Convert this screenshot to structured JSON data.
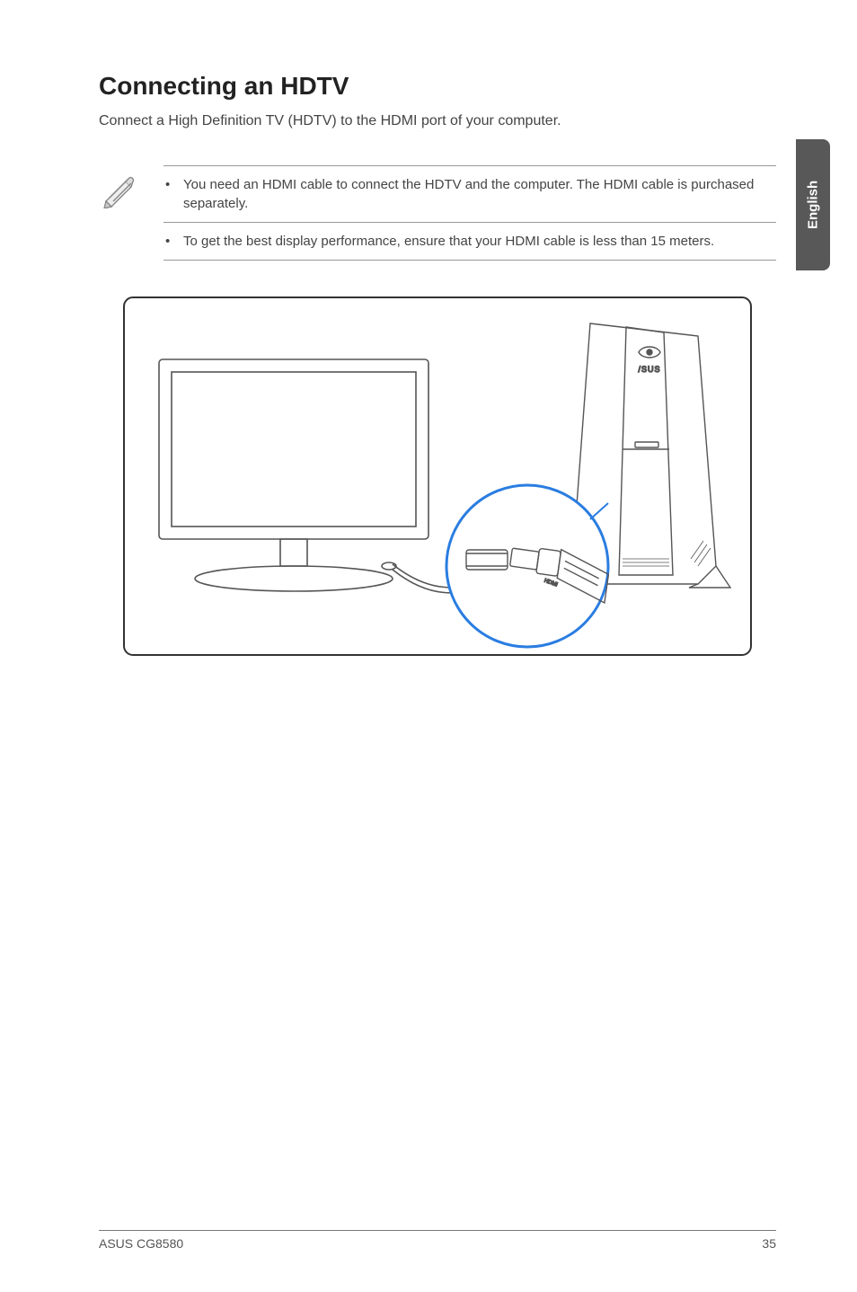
{
  "sidebar": {
    "language": "English"
  },
  "heading": "Connecting an HDTV",
  "intro": "Connect a High Definition TV (HDTV) to the HDMI port of your computer.",
  "notes": [
    "You need an HDMI cable to connect the HDTV and the computer. The HDMI cable is purchased separately.",
    "To get the best display performance, ensure that your HDMI cable is less than 15 meters."
  ],
  "footer": {
    "left": "ASUS CG8580",
    "right": "35"
  }
}
